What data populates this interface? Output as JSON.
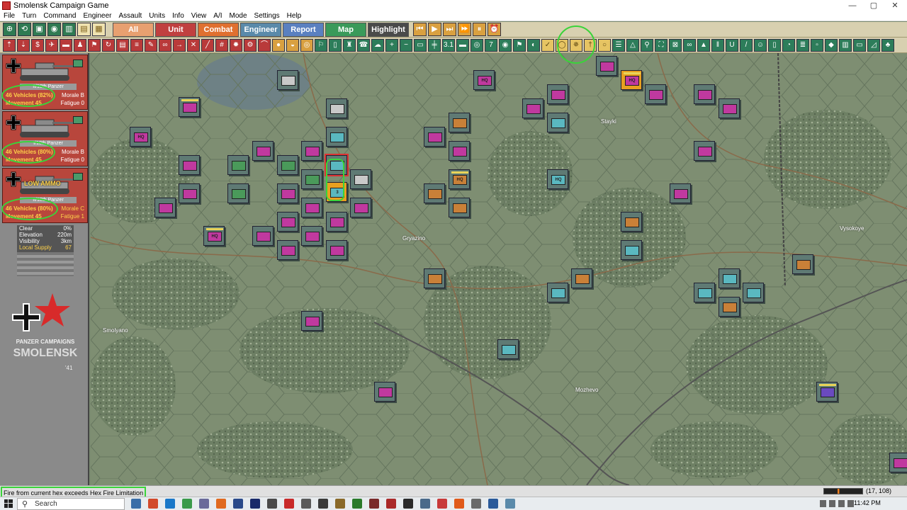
{
  "window": {
    "title": "Smolensk Campaign Game",
    "minimize": "—",
    "maximize": "▢",
    "close": "✕"
  },
  "menu": [
    "File",
    "Turn",
    "Command",
    "Engineer",
    "Assault",
    "Units",
    "Info",
    "View",
    "A/I",
    "Mode",
    "Settings",
    "Help"
  ],
  "tabs": [
    {
      "label": "All",
      "color": "#e8a070"
    },
    {
      "label": "Unit",
      "color": "#c04040"
    },
    {
      "label": "Combat",
      "color": "#e07030"
    },
    {
      "label": "Engineer",
      "color": "#5a8aaa"
    },
    {
      "label": "Report",
      "color": "#5a80c0"
    },
    {
      "label": "Map",
      "color": "#3a9a5a"
    },
    {
      "label": "Highlight",
      "color": "#4a4a4a"
    }
  ],
  "toolbar2_counter": "3.1",
  "toolbar2_seven": "7",
  "units": [
    {
      "name": "II/18th Panzer",
      "vehicles": "46 Vehicles (82%)",
      "movement": "Movement 45",
      "morale": "Morale B",
      "fatigue": "Fatigue 0",
      "warning": ""
    },
    {
      "name": "I/18th Panzer",
      "vehicles": "46 Vehicles (80%)",
      "movement": "Movement 45",
      "morale": "Morale B",
      "fatigue": "Fatigue 0",
      "warning": ""
    },
    {
      "name": "II/18th Panzer",
      "vehicles": "46 Vehicles (80%)",
      "movement": "Movement 45",
      "morale": "Morale C",
      "fatigue": "Fatigue 1",
      "warning": "LOW AMMO"
    }
  ],
  "terrain": [
    {
      "k": "Clear",
      "v": "0%"
    },
    {
      "k": "Elevation",
      "v": "220m"
    },
    {
      "k": "Visibility",
      "v": "3km"
    },
    {
      "k": "Local Supply",
      "v": "67"
    }
  ],
  "logo": {
    "line1": "PANZER CAMPAIGNS",
    "line2": "SMOLENSK",
    "line3": "'41"
  },
  "towns": [
    {
      "name": "Stayki"
    },
    {
      "name": "Gryazino"
    },
    {
      "name": "Smolyano"
    },
    {
      "name": "Mozhevo"
    },
    {
      "name": "Vysokoye"
    }
  ],
  "hq_label": "HQ",
  "stack_label": "3",
  "status": {
    "message": "Fire from current hex exceeds Hex Fire Limitation",
    "hex": "(17, 108)"
  },
  "taskbar": {
    "search": "Search",
    "time": "11:42 PM"
  },
  "colors": {
    "axis_card": "#b8463c",
    "toolbar": "#d8d0b0",
    "map": "#7d8d72",
    "highlight": "#3ad43a"
  }
}
